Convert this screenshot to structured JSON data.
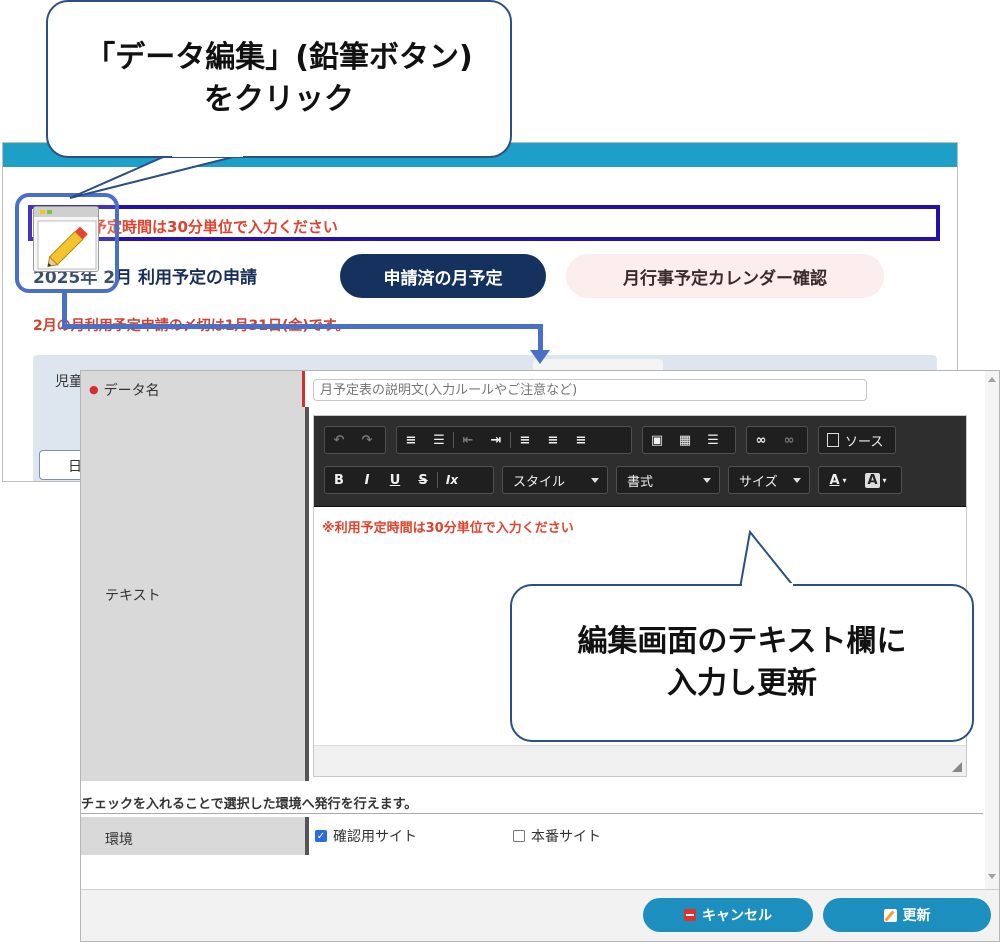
{
  "back_page": {
    "notice_text": "予定時間は30分単位で入力ください",
    "month_title": "2025年 2月 利用予定の申請",
    "applied_button": "申請済の月予定",
    "calendar_button": "月行事予定カレンダー確認",
    "deadline_text": "2月の月利用予定申請の〆切は1月31日(金)です。",
    "child_label": "児童名",
    "child_button": "日"
  },
  "dialog": {
    "name_label": "データ名",
    "name_placeholder": "月予定表の説明文(入力ルールやご注意など)",
    "text_label": "テキスト",
    "toolbar": {
      "source_label": "ソース",
      "style_label": "スタイル",
      "format_label": "書式",
      "size_label": "サイズ",
      "bold": "B",
      "italic": "I",
      "underline": "U",
      "strike": "S",
      "clear_format": "Ix",
      "text_color": "A",
      "bg_color": "A"
    },
    "editor_content": "※利用予定時間は30分単位で入力ください",
    "publish_note": "チェックを入れることで選択した環境へ発行を行えます。",
    "env_label": "環境",
    "env_options": [
      {
        "label": "確認用サイト",
        "checked": true
      },
      {
        "label": "本番サイト",
        "checked": false
      }
    ],
    "cancel_button": "キャンセル",
    "update_button": "更新"
  },
  "callouts": {
    "top_line1": "「データ編集」(鉛筆ボタン)",
    "top_line2": "をクリック",
    "bottom_line1": "編集画面のテキスト欄に",
    "bottom_line2": "入力し更新"
  },
  "colors": {
    "header_bar": "#1e9fc8",
    "highlight_box": "#2410b0",
    "notice_red": "#e0422b",
    "navy_button": "#15315e",
    "connector_blue": "#4a6fc7",
    "footer_button": "#1d8fbf"
  }
}
